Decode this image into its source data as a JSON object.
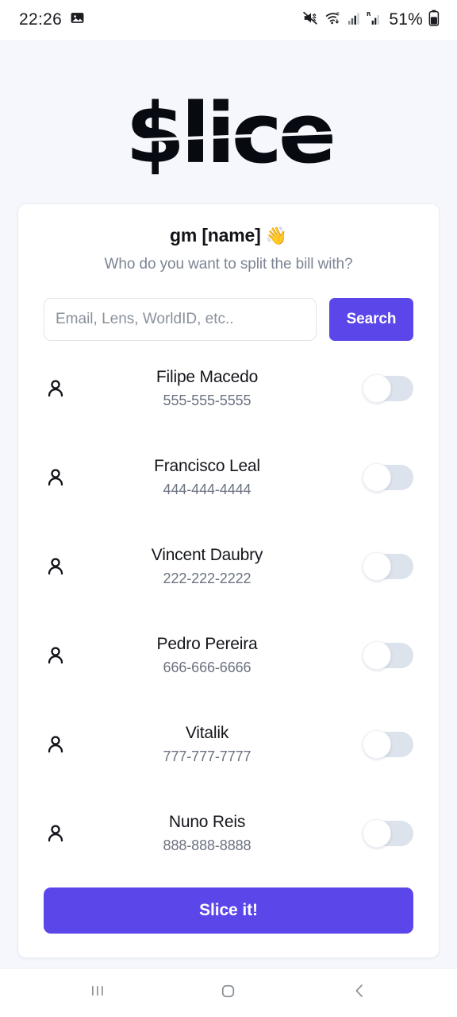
{
  "status_bar": {
    "clock": "22:26",
    "battery_percent": "51%",
    "icons": [
      "image-icon",
      "mute-icon",
      "wifi-icon",
      "signal-icon",
      "roaming-signal-icon",
      "battery-icon"
    ]
  },
  "app": {
    "logo_text": "$lice",
    "accent_color": "#5b46ea",
    "page_background": "#f6f7fd"
  },
  "card": {
    "greeting": "gm [name]",
    "greeting_emoji": "👋",
    "subtitle": "Who do you want to split the bill with?",
    "search": {
      "placeholder": "Email, Lens, WorldID, etc..",
      "value": "",
      "button_label": "Search"
    },
    "contacts": [
      {
        "name": "Filipe Macedo",
        "phone": "555-555-5555",
        "enabled": "off"
      },
      {
        "name": "Francisco Leal",
        "phone": "444-444-4444",
        "enabled": "off"
      },
      {
        "name": "Vincent Daubry",
        "phone": "222-222-2222",
        "enabled": "off"
      },
      {
        "name": "Pedro Pereira",
        "phone": "666-666-6666",
        "enabled": "off"
      },
      {
        "name": "Vitalik",
        "phone": "777-777-7777",
        "enabled": "off"
      },
      {
        "name": "Nuno Reis",
        "phone": "888-888-8888",
        "enabled": "off"
      }
    ],
    "cta_label": "Slice it!"
  },
  "nav_bar": {
    "recents_label": "recents-icon",
    "home_label": "home-icon",
    "back_label": "back-icon"
  }
}
